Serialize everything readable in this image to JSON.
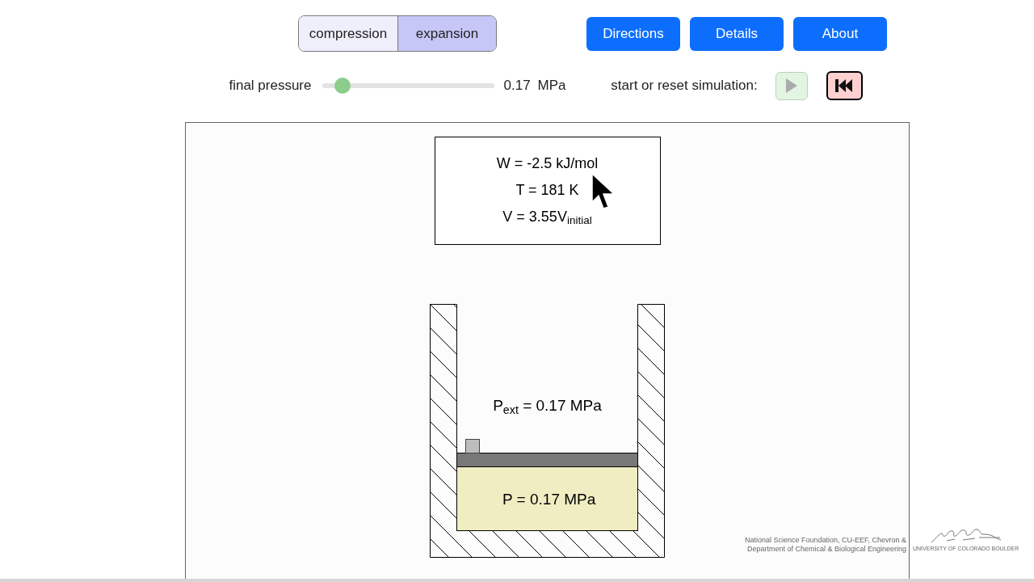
{
  "mode_toggle": [
    {
      "label": "compression",
      "selected": false
    },
    {
      "label": "expansion",
      "selected": true
    }
  ],
  "header_buttons": [
    "Directions",
    "Details",
    "About"
  ],
  "final_pressure": {
    "label": "final pressure",
    "level": 0.08,
    "value": "0.17",
    "unit": "MPa"
  },
  "simulation_controls": {
    "label": "start or reset simulation:",
    "buttons": [
      {
        "kind": "play",
        "disabled": true
      },
      {
        "kind": "reset",
        "disabled": false
      }
    ]
  },
  "readout": {
    "lines": [
      "W = -2.5 kJ/mol",
      "T = 181 K",
      "V = 3.55V$_{initial}$"
    ]
  },
  "cylinder": {
    "external_pressure": "P$_{ext}$ = 0.17 MPa",
    "gas_pressure": "P = 0.17 MPa"
  },
  "credits": {
    "lines": [
      "National Science Foundation, CU-EEF, Chevron &",
      "Department of Chemical & Biological Engineering"
    ],
    "logo_caption": "UNIVERSITY OF COLORADO BOULDER"
  }
}
